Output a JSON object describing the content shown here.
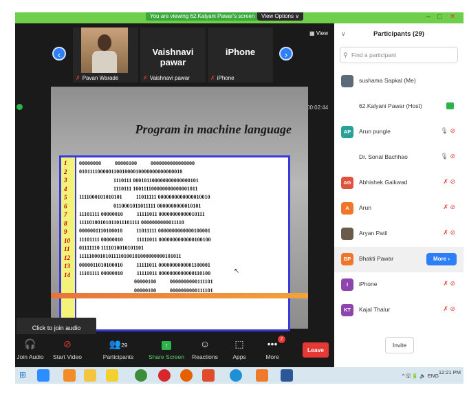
{
  "banner": {
    "sharing_text": "You are viewing 62.Kalyani Pawar's screen",
    "view_options": "View Options ∨"
  },
  "video_strip": {
    "tiles": [
      {
        "caption": "Pavan Warade"
      },
      {
        "name": "Vaishnavi pawar",
        "caption": "Vaishnavi pawar"
      },
      {
        "name": "iPhone",
        "caption": "iPhone"
      }
    ],
    "view_label": "View",
    "prev_icon": "‹",
    "next_icon": "›"
  },
  "timer": "00:02:44",
  "slide": {
    "title": "Program in machine language",
    "line_numbers": [
      "1",
      "2",
      "3",
      "4",
      "5",
      "6",
      "7",
      "8",
      "9",
      "10",
      "11",
      "12",
      "13",
      "14"
    ],
    "code_lines": [
      "00000000          00000100          0000000000000000",
      "01011110000011001000010000000000000010",
      "                         1110111 000101100000000000000101",
      "                         1110111 100111100000000000001011",
      "1111000101010101          11011111 0000000000000010010",
      "                         0110001011011111 0000000000010101",
      "11101111 00000010          11111011 00000000000010111",
      "11110100101011011101111 0000000000011110",
      "0000001110100010          11011111 0000000000000100001",
      "11101111 00000010          11111011 0000000000000100100",
      "01111110 1111010010101101",
      "11111000101011110100101000000000101011",
      "0000011010100010          11111011 0000000000001100001",
      "11101111 00000010          11111011 0000000000000110100",
      "                                        00000100          0000000000111101",
      "                                        00000100          0000000000111101"
    ]
  },
  "tooltip": "Click to join audio",
  "toolbar": {
    "join_audio": "Join Audio",
    "start_video": "Start Video",
    "participants": "Participants",
    "participants_count": "29",
    "share_screen": "Share Screen",
    "reactions": "Reactions",
    "apps": "Apps",
    "more": "More",
    "more_badge": "2",
    "leave": "Leave"
  },
  "panel": {
    "title": "Participants (29)",
    "search_placeholder": "Find a participant",
    "participants": [
      {
        "name": "sushama Sapkal (Me)",
        "avatar": "",
        "color": "#5b6b7a"
      },
      {
        "name": "62.Kalyani Pawar (Host)",
        "avatar": "",
        "color": "#ffffff"
      },
      {
        "name": "Arun pungle",
        "avatar": "AP",
        "color": "#2aa198"
      },
      {
        "name": "Dr. Sonal Bachhao",
        "avatar": "",
        "color": "#ffffff"
      },
      {
        "name": "Abhishek Gaikwad",
        "avatar": "AG",
        "color": "#e0533f"
      },
      {
        "name": "Arun",
        "avatar": "A",
        "color": "#f0762b"
      },
      {
        "name": "Aryan Patil",
        "avatar": "",
        "color": "#6a5a4a"
      },
      {
        "name": "Bhakti Pawar",
        "avatar": "BP",
        "color": "#f0762b"
      },
      {
        "name": "iPhone",
        "avatar": "I",
        "color": "#8e44ad"
      },
      {
        "name": "Kajal Thalur",
        "avatar": "KT",
        "color": "#8e44ad"
      }
    ],
    "more_button": "More ›",
    "invite": "Invite"
  },
  "taskbar": {
    "language": "ENG",
    "time": "12:21 PM",
    "tray_icons": "^ 🖫 🔋 🔈"
  }
}
